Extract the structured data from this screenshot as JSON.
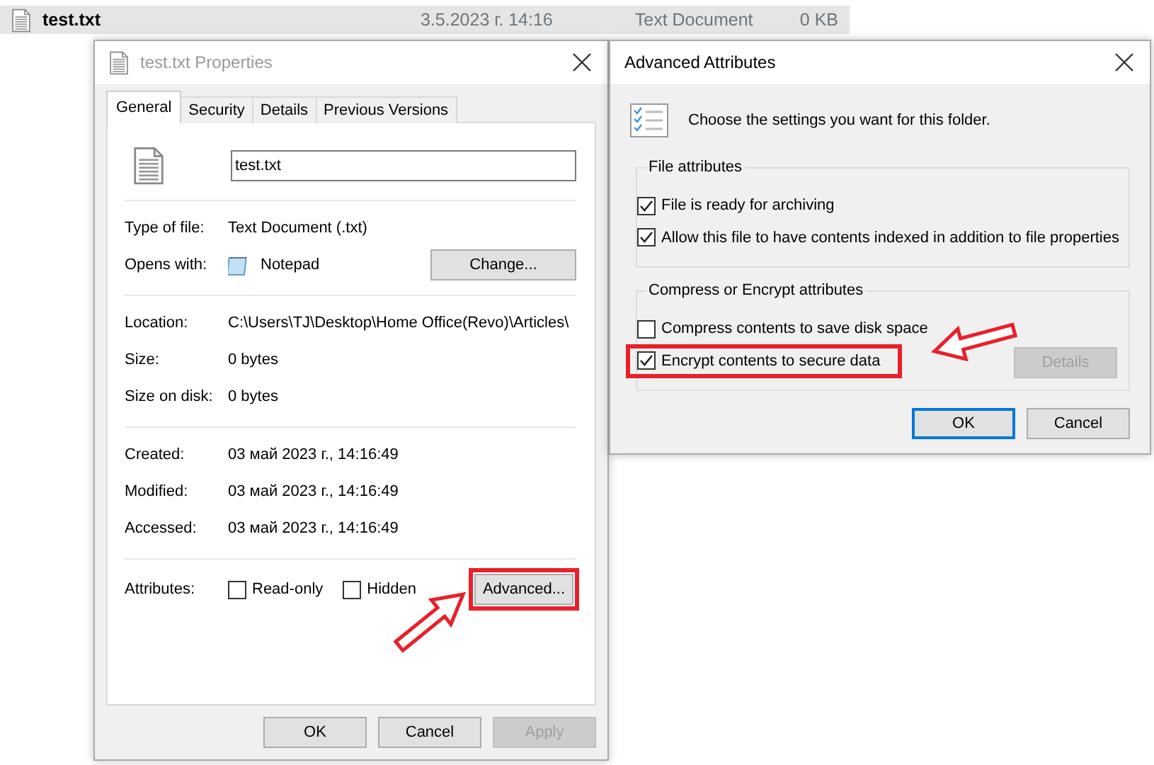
{
  "file_row": {
    "name": "test.txt",
    "date": "3.5.2023 г. 14:16",
    "type": "Text Document",
    "size": "0 KB"
  },
  "properties": {
    "title": "test.txt Properties",
    "tabs": [
      {
        "label": "General",
        "selected": true
      },
      {
        "label": "Security",
        "selected": false
      },
      {
        "label": "Details",
        "selected": false
      },
      {
        "label": "Previous Versions",
        "selected": false
      }
    ],
    "file_name": "test.txt",
    "sections": [
      [
        {
          "kind": "text",
          "label": "Type of file:",
          "value": "Text Document (.txt)"
        },
        {
          "kind": "app",
          "label": "Opens with:",
          "value": "Notepad",
          "button": "Change..."
        }
      ],
      [
        {
          "kind": "text",
          "label": "Location:",
          "value": "C:\\Users\\TJ\\Desktop\\Home Office(Revo)\\Articles\\"
        },
        {
          "kind": "text",
          "label": "Size:",
          "value": "0 bytes"
        },
        {
          "kind": "text",
          "label": "Size on disk:",
          "value": "0 bytes"
        }
      ],
      [
        {
          "kind": "text",
          "label": "Created:",
          "value": "03 май 2023 г., 14:16:49"
        },
        {
          "kind": "text",
          "label": "Modified:",
          "value": "03 май 2023 г., 14:16:49"
        },
        {
          "kind": "text",
          "label": "Accessed:",
          "value": "03 май 2023 г., 14:16:49"
        }
      ]
    ],
    "attributes": {
      "label": "Attributes:",
      "options": [
        {
          "label": "Read-only",
          "checked": false
        },
        {
          "label": "Hidden",
          "checked": false
        }
      ],
      "advanced_button": {
        "label": "Advanced...",
        "highlighted": true
      }
    },
    "buttons": [
      {
        "label": "OK",
        "disabled": false
      },
      {
        "label": "Cancel",
        "disabled": false
      },
      {
        "label": "Apply",
        "disabled": true
      }
    ]
  },
  "advanced": {
    "title": "Advanced Attributes",
    "description": "Choose the settings you want for this folder.",
    "groups": [
      {
        "title": "File attributes",
        "options": [
          {
            "label": "File is ready for archiving",
            "checked": true,
            "highlighted": false
          },
          {
            "label": "Allow this file to have contents indexed in addition to file properties",
            "checked": true,
            "highlighted": false
          }
        ]
      },
      {
        "title": "Compress or Encrypt attributes",
        "options": [
          {
            "label": "Compress contents to save disk space",
            "checked": false,
            "highlighted": false
          },
          {
            "label": "Encrypt contents to secure data",
            "checked": true,
            "highlighted": true
          }
        ],
        "button": {
          "label": "Details",
          "disabled": true
        }
      }
    ],
    "buttons": [
      {
        "label": "OK",
        "default": true
      },
      {
        "label": "Cancel",
        "default": false
      }
    ]
  }
}
